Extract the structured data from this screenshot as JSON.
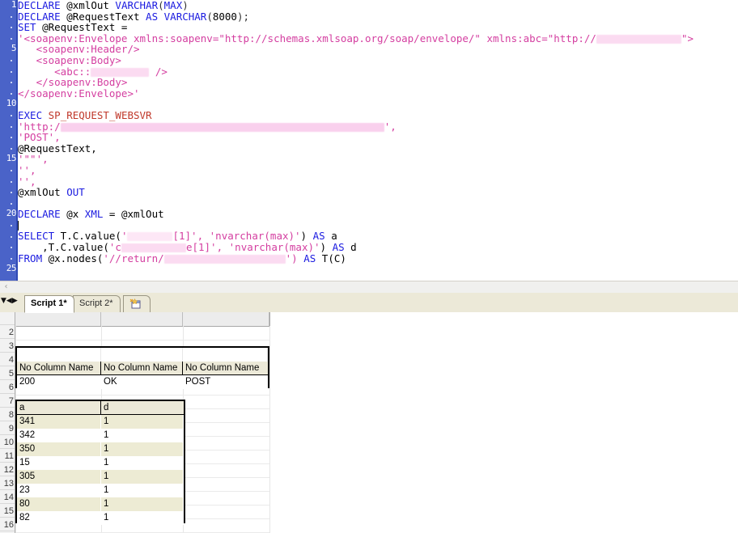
{
  "editor": {
    "gutter_numbers": [
      "1",
      "5",
      "10",
      "15",
      "20",
      "25"
    ],
    "lines": [
      {
        "n": 1,
        "segments": [
          {
            "t": "DECLARE",
            "c": "kw"
          },
          {
            "t": " @xmlOut ",
            "c": "plain"
          },
          {
            "t": "VARCHAR",
            "c": "kw"
          },
          {
            "t": "(",
            "c": "punct"
          },
          {
            "t": "MAX",
            "c": "kw"
          },
          {
            "t": ")",
            "c": "punct"
          }
        ]
      },
      {
        "n": 2,
        "segments": [
          {
            "t": "DECLARE",
            "c": "kw"
          },
          {
            "t": " @RequestText ",
            "c": "plain"
          },
          {
            "t": "AS",
            "c": "kw"
          },
          {
            "t": " ",
            "c": "plain"
          },
          {
            "t": "VARCHAR",
            "c": "kw"
          },
          {
            "t": "(",
            "c": "punct"
          },
          {
            "t": "8000",
            "c": "plain"
          },
          {
            "t": ");",
            "c": "punct"
          }
        ]
      },
      {
        "n": 3,
        "segments": [
          {
            "t": "SET",
            "c": "kw"
          },
          {
            "t": " @RequestText =",
            "c": "plain"
          }
        ]
      },
      {
        "n": 4,
        "segments": [
          {
            "t": "'<soapenv:Envelope xmlns:soapenv=\"http://schemas.xmlsoap.org/soap/envelope/\" xmlns:abc=\"http://",
            "c": "str"
          },
          {
            "redact": 105
          },
          {
            "t": "\">",
            "c": "str"
          }
        ]
      },
      {
        "n": 5,
        "segments": [
          {
            "t": "   <soapenv:Header/>",
            "c": "str"
          }
        ]
      },
      {
        "n": 6,
        "segments": [
          {
            "t": "   <soapenv:Body>",
            "c": "str"
          }
        ]
      },
      {
        "n": 7,
        "segments": [
          {
            "t": "      <abc::",
            "c": "str"
          },
          {
            "redact": 72
          },
          {
            "t": " />",
            "c": "str"
          }
        ]
      },
      {
        "n": 8,
        "segments": [
          {
            "t": "   </soapenv:Body>",
            "c": "str"
          }
        ]
      },
      {
        "n": 9,
        "segments": [
          {
            "t": "</soapenv:Envelope>'",
            "c": "str"
          }
        ]
      },
      {
        "n": 10,
        "segments": []
      },
      {
        "n": 11,
        "segments": [
          {
            "t": "EXEC",
            "c": "kw"
          },
          {
            "t": " ",
            "c": "plain"
          },
          {
            "t": "SP_REQUEST_WEBSVR",
            "c": "fn"
          }
        ]
      },
      {
        "n": 12,
        "segments": [
          {
            "t": "'http:/",
            "c": "str"
          },
          {
            "redact": 400
          },
          {
            "t": "',",
            "c": "str"
          }
        ]
      },
      {
        "n": 13,
        "segments": [
          {
            "t": "'POST',",
            "c": "str"
          }
        ]
      },
      {
        "n": 14,
        "segments": [
          {
            "t": "@RequestText,",
            "c": "plain"
          }
        ]
      },
      {
        "n": 15,
        "segments": [
          {
            "t": "'\"\"',",
            "c": "str"
          }
        ]
      },
      {
        "n": 16,
        "segments": [
          {
            "t": "'',",
            "c": "str"
          }
        ]
      },
      {
        "n": 17,
        "segments": [
          {
            "t": "'',",
            "c": "str"
          }
        ]
      },
      {
        "n": 18,
        "segments": [
          {
            "t": "@xmlOut ",
            "c": "plain"
          },
          {
            "t": "OUT",
            "c": "kw"
          }
        ]
      },
      {
        "n": 19,
        "segments": []
      },
      {
        "n": 20,
        "segments": [
          {
            "t": "DECLARE",
            "c": "kw"
          },
          {
            "t": " @x ",
            "c": "plain"
          },
          {
            "t": "XML",
            "c": "kw"
          },
          {
            "t": " = @xmlOut",
            "c": "plain"
          }
        ]
      },
      {
        "n": 21,
        "segments": [],
        "caret": true
      },
      {
        "n": 22,
        "segments": [
          {
            "t": "SELECT",
            "c": "kw"
          },
          {
            "t": " T.C.value(",
            "c": "plain"
          },
          {
            "t": "'",
            "c": "str"
          },
          {
            "redact": 56
          },
          {
            "t": "[1]',",
            "c": "str"
          },
          {
            "t": " ",
            "c": "plain"
          },
          {
            "t": "'nvarchar(max)'",
            "c": "str"
          },
          {
            "t": ") ",
            "c": "plain"
          },
          {
            "t": "AS",
            "c": "kw"
          },
          {
            "t": " a",
            "c": "plain"
          }
        ]
      },
      {
        "n": 23,
        "segments": [
          {
            "t": "    ,T.C.value(",
            "c": "plain"
          },
          {
            "t": "'c",
            "c": "str"
          },
          {
            "redact": 80
          },
          {
            "t": "e[1]',",
            "c": "str"
          },
          {
            "t": " ",
            "c": "plain"
          },
          {
            "t": "'nvarchar(max)'",
            "c": "str"
          },
          {
            "t": ") ",
            "c": "plain"
          },
          {
            "t": "AS",
            "c": "kw"
          },
          {
            "t": " d",
            "c": "plain"
          }
        ]
      },
      {
        "n": 24,
        "segments": [
          {
            "t": "FROM",
            "c": "kw"
          },
          {
            "t": " @x.nodes(",
            "c": "plain"
          },
          {
            "t": "'//return/",
            "c": "str"
          },
          {
            "redact": 150
          },
          {
            "t": "') ",
            "c": "str"
          },
          {
            "t": "AS",
            "c": "kw"
          },
          {
            "t": " T(C)",
            "c": "plain"
          }
        ]
      }
    ],
    "hscroll_left_arrow": "‹"
  },
  "tabstrip": {
    "nav": {
      "dropdown": "▼",
      "prev": "◀",
      "next": "▶"
    },
    "tabs": [
      {
        "label": "Script 1*",
        "active": true
      },
      {
        "label": "Script 2*",
        "active": false
      }
    ],
    "icon_tab_name": "object-explorer-tab"
  },
  "results": {
    "row_numbers": [
      "",
      "2",
      "3",
      "4",
      "5",
      "6",
      "7",
      "8",
      "9",
      "10",
      "11",
      "12",
      "13",
      "14",
      "15",
      "16"
    ],
    "table1": {
      "headers": [
        "No Column Name",
        "No Column Name",
        "No Column Name"
      ],
      "rows": [
        [
          "200",
          "OK",
          "POST"
        ]
      ]
    },
    "table2": {
      "headers": [
        "a",
        "d"
      ],
      "rows": [
        [
          "341",
          "1"
        ],
        [
          "342",
          "1"
        ],
        [
          "350",
          "1"
        ],
        [
          "15",
          "1"
        ],
        [
          "305",
          "1"
        ],
        [
          "23",
          "1"
        ],
        [
          "80",
          "1"
        ],
        [
          "82",
          "1"
        ]
      ]
    }
  },
  "colors": {
    "gutter_blue": "#4a63c8",
    "keyword_blue": "#1b1be0",
    "string_pink": "#d43ea0",
    "proc_red": "#c0392b",
    "redaction_pink": "#fbd8f0",
    "tab_beige": "#ece9d8",
    "grid_zebra": "#edebd4",
    "selection_red": "#c0392b"
  }
}
